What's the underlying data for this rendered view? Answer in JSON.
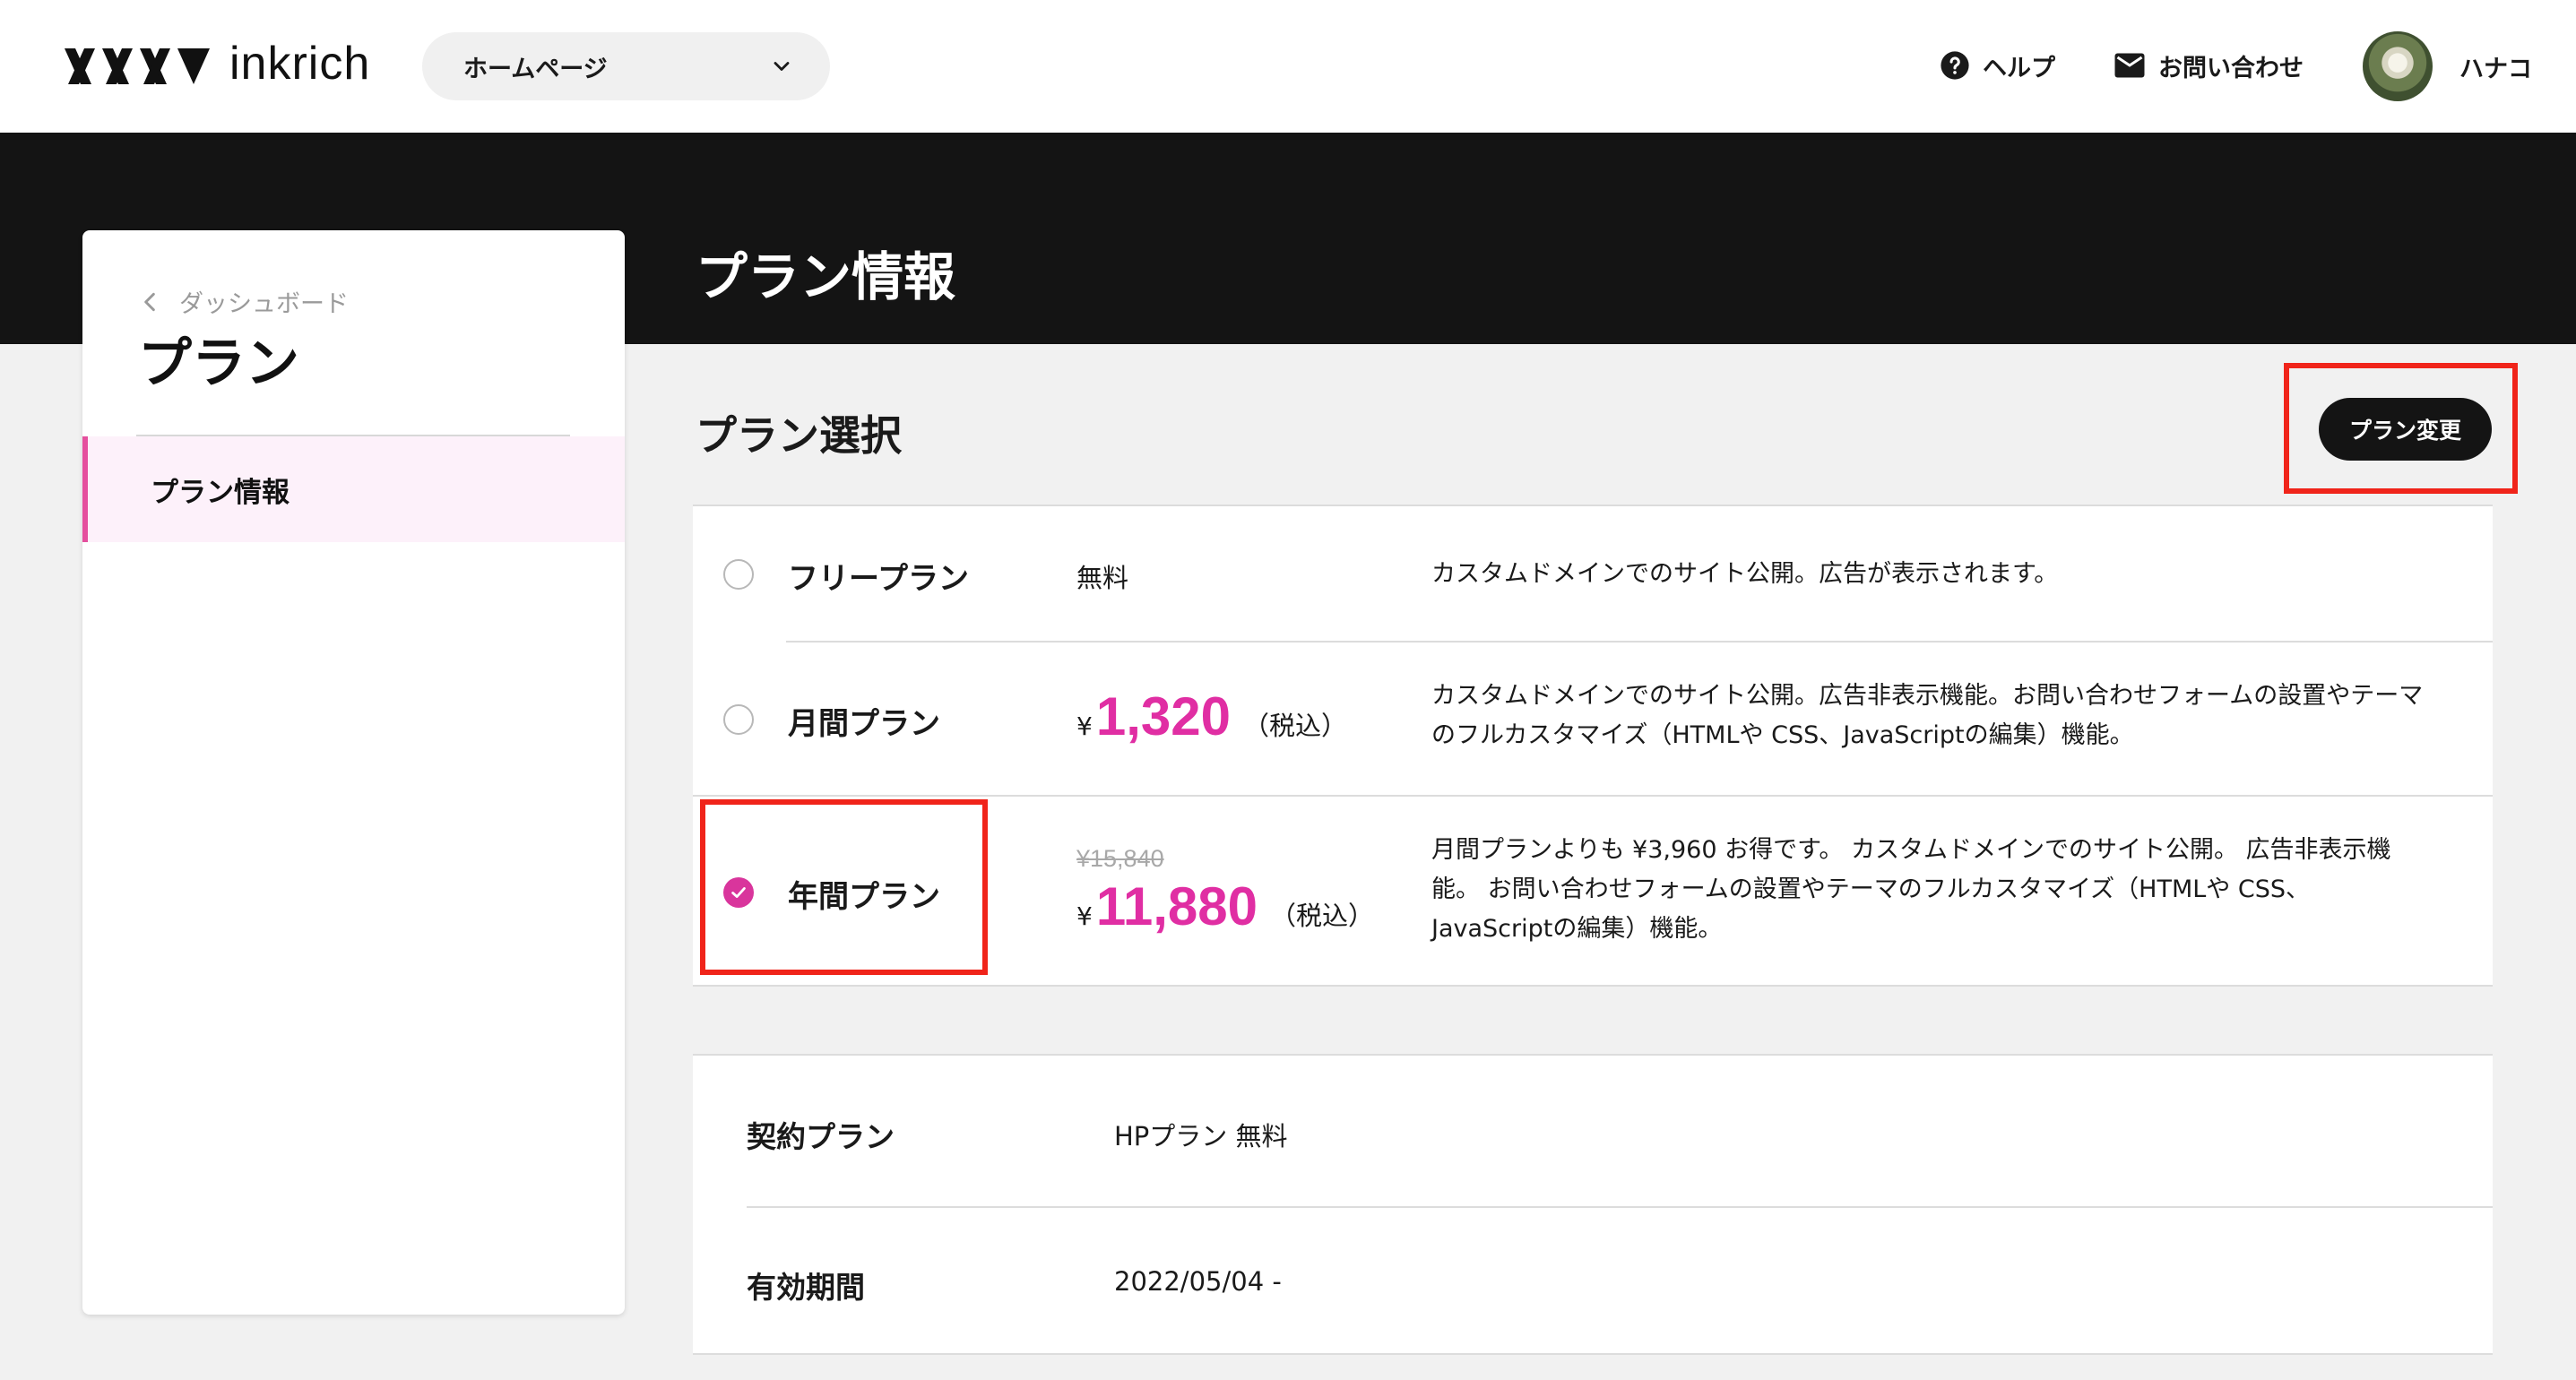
{
  "header": {
    "logo_text": "inkrich",
    "site_select": {
      "value": "ホームページ"
    },
    "nav": {
      "help": "ヘルプ",
      "contact": "お問い合わせ",
      "user_name": "ハナコ"
    }
  },
  "page": {
    "title": "プラン情報"
  },
  "sidebar": {
    "back_label": "ダッシュボード",
    "title": "プラン",
    "items": [
      {
        "label": "プラン情報",
        "active": true
      }
    ]
  },
  "plan_selection": {
    "title": "プラン選択",
    "change_button": "プラン変更",
    "plans": [
      {
        "name": "フリープラン",
        "price_text": "無料",
        "description": "カスタムドメインでのサイト公開。広告が表示されます。",
        "selected": false
      },
      {
        "name": "月間プラン",
        "currency": "¥",
        "price": "1,320",
        "tax_note": "（税込）",
        "description_lines": [
          "カスタムドメインでのサイト公開。広告非表示機能。お問い合わせフォームの設置やテーマ",
          "のフルカスタマイズ（HTMLや CSS、JavaScriptの編集）機能。"
        ],
        "selected": false
      },
      {
        "name": "年間プラン",
        "original_price": "¥15,840",
        "currency": "¥",
        "price": "11,880",
        "tax_note": "（税込）",
        "description_lines": [
          "月間プランよりも ¥3,960 お得です。 カスタムドメインでのサイト公開。 広告非表示機",
          "能。 お問い合わせフォームの設置やテーマのフルカスタマイズ（HTMLや CSS、",
          "JavaScriptの編集）機能。"
        ],
        "selected": true
      }
    ]
  },
  "contract": {
    "plan_label": "契約プラン",
    "plan_value": "HPプラン 無料",
    "period_label": "有効期間",
    "period_value": "2022/05/04 -"
  },
  "colors": {
    "accent": "#e02ea3",
    "highlight": "#f0241a",
    "dark": "#141414"
  }
}
